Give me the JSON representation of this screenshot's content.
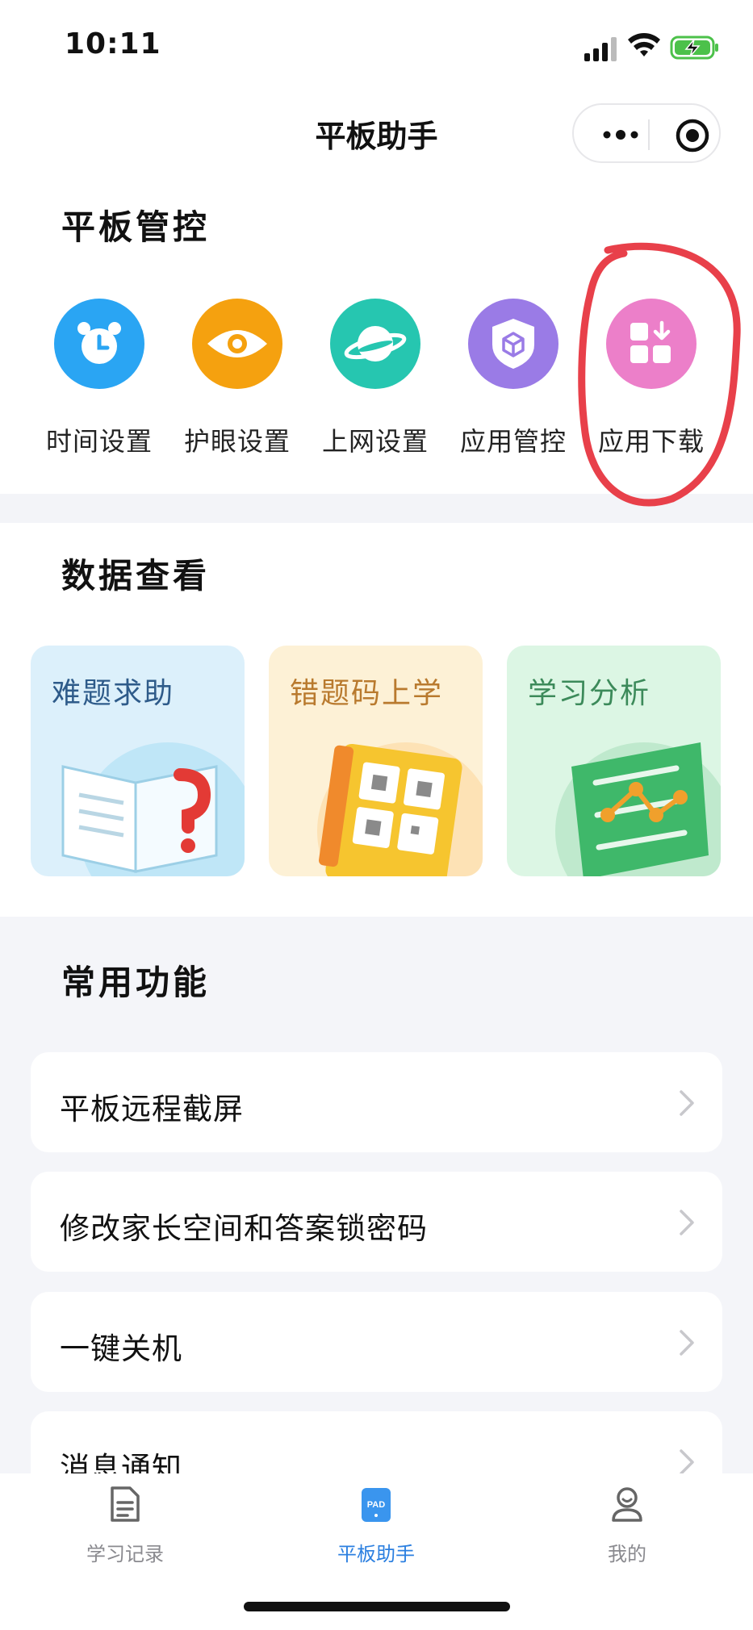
{
  "status_bar": {
    "time": "10:11"
  },
  "nav": {
    "title": "平板助手"
  },
  "control": {
    "title": "平板管控",
    "items": [
      {
        "label": "时间设置",
        "icon": "alarm-clock-icon",
        "color": "#2aa5f3"
      },
      {
        "label": "护眼设置",
        "icon": "eye-icon",
        "color": "#f5a10f"
      },
      {
        "label": "上网设置",
        "icon": "planet-icon",
        "color": "#26c6b0"
      },
      {
        "label": "应用管控",
        "icon": "shield-cube-icon",
        "color": "#9a7be6"
      },
      {
        "label": "应用下载",
        "icon": "app-download-icon",
        "color": "#ec7fc9"
      }
    ],
    "annotation_color": "#e8404a"
  },
  "data_view": {
    "title": "数据查看",
    "cards": [
      {
        "label": "难题求助",
        "text_color": "#2e5b8a",
        "bg": "#dcf0fb"
      },
      {
        "label": "错题码上学",
        "text_color": "#b97a2e",
        "bg": "#fdf1d6"
      },
      {
        "label": "学习分析",
        "text_color": "#3c8a5a",
        "bg": "#dcf6e4"
      }
    ]
  },
  "common": {
    "title": "常用功能",
    "rows": [
      {
        "label": "平板远程截屏"
      },
      {
        "label": "修改家长空间和答案锁密码"
      },
      {
        "label": "一键关机"
      },
      {
        "label": "消息通知"
      }
    ]
  },
  "tabbar": {
    "tabs": [
      {
        "label": "学习记录",
        "icon": "document-icon"
      },
      {
        "label": "平板助手",
        "icon": "pad-icon",
        "badge": "PAD"
      },
      {
        "label": "我的",
        "icon": "user-icon"
      }
    ],
    "active_color": "#2b7fe0"
  }
}
